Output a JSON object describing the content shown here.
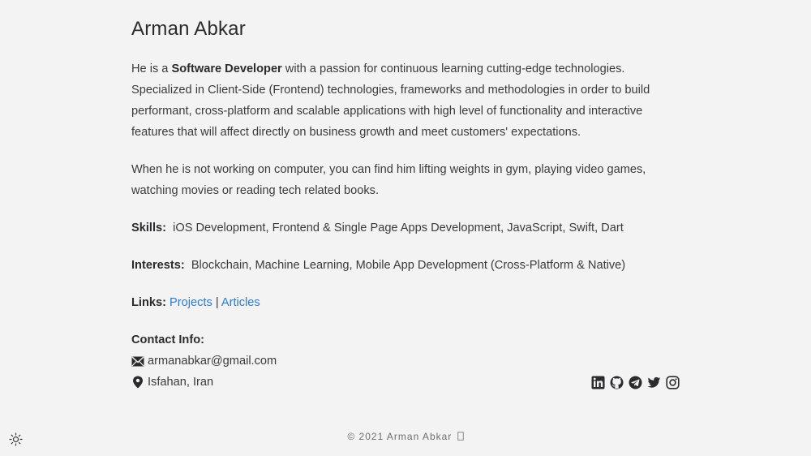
{
  "profile": {
    "name": "Arman Abkar",
    "bio_prefix": "He is a ",
    "bio_highlight": "Software Developer",
    "bio_suffix": " with a passion for continuous learning cutting-edge technologies. Specialized in Client-Side (Frontend) technologies, frameworks and methodologies in order to build performant, cross-platform and scalable applications with high level of functionality and interactive features that will affect directly on business growth and meet customers' expectations.",
    "hobbies": "When he is not working on computer, you can find him lifting weights in gym, playing video games, watching movies or reading tech related books."
  },
  "skills": {
    "label": "Skills:",
    "value": "iOS Development, Frontend & Single Page Apps Development, JavaScript, Swift, Dart"
  },
  "interests": {
    "label": "Interests:",
    "value": "Blockchain, Machine Learning, Mobile App Development (Cross-Platform & Native)"
  },
  "links": {
    "label": "Links:",
    "projects": "Projects",
    "separator": "|",
    "articles": "Articles",
    "color": "#2b7bd6"
  },
  "contact": {
    "title": "Contact Info:",
    "email": "armanabkar@gmail.com",
    "location": "Isfahan, Iran",
    "email_icon": "envelope-icon",
    "location_icon": "map-marker-icon"
  },
  "socials": [
    {
      "icon": "linkedin-icon"
    },
    {
      "icon": "github-icon"
    },
    {
      "icon": "telegram-icon"
    },
    {
      "icon": "twitter-icon"
    },
    {
      "icon": "instagram-icon"
    }
  ],
  "footer": {
    "text": "© 2021 Arman Abkar",
    "trailing_icon": "heart-icon"
  },
  "theme_toggle": {
    "icon": "sun-icon"
  }
}
